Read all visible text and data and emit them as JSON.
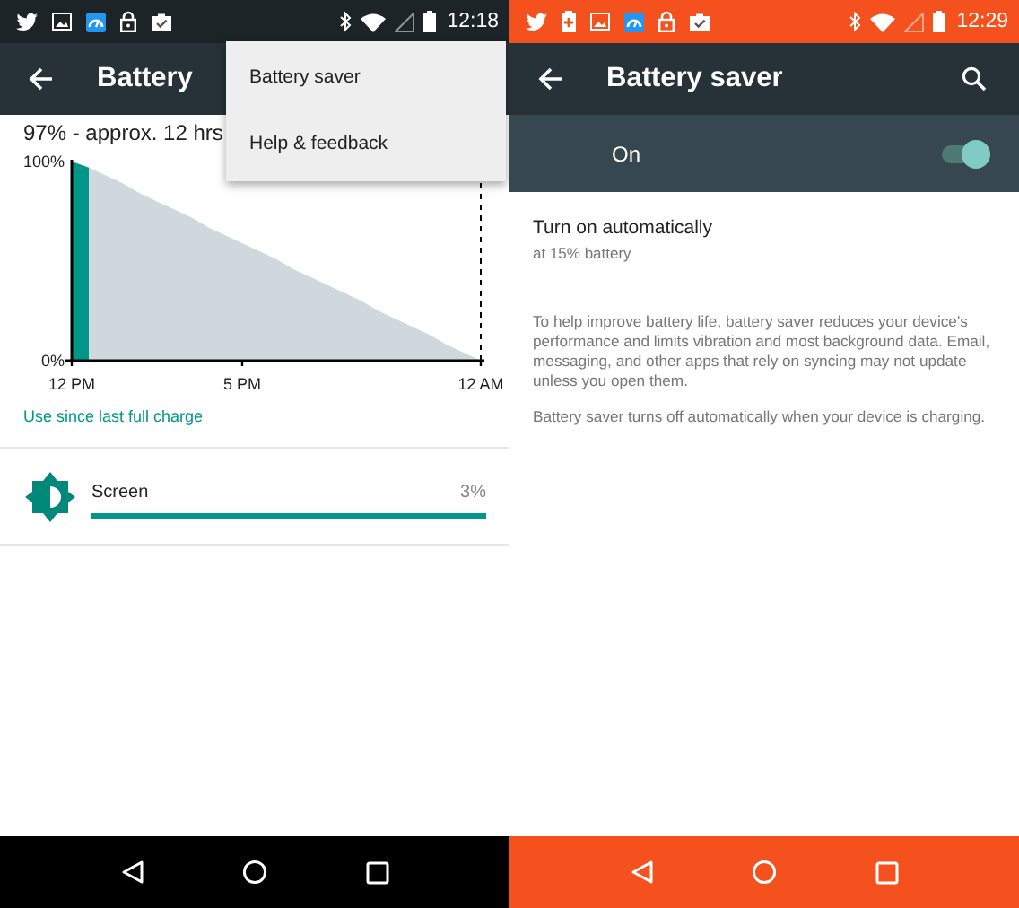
{
  "left_screen": {
    "status_bar": {
      "time": "12:18"
    },
    "toolbar": {
      "title": "Battery"
    },
    "summary": "97% - approx. 12 hrs",
    "chart_data": {
      "type": "area",
      "categories": [
        "12 PM",
        null,
        null,
        null,
        null,
        null,
        null,
        null,
        null,
        null,
        "5 PM",
        null,
        null,
        null,
        null,
        null,
        null,
        null,
        null,
        null,
        null,
        null,
        null,
        null,
        "12 AM"
      ],
      "yticks": [
        {
          "value": 0,
          "label": "0%"
        },
        {
          "value": 100,
          "label": "100%"
        }
      ],
      "ylim": [
        0,
        100
      ],
      "series": [
        {
          "color": "#009688",
          "values": [
            100,
            97,
            null,
            null,
            null,
            null,
            null,
            null,
            null,
            null,
            null,
            null,
            null,
            null,
            null,
            null,
            null,
            null,
            null,
            null,
            null,
            null,
            null,
            null,
            null
          ]
        },
        {
          "color": "#cfd8dc",
          "values": [
            null,
            97,
            93,
            89,
            84,
            80,
            76,
            72,
            67,
            63,
            59,
            55,
            51,
            46,
            42,
            38,
            34,
            30,
            25,
            21,
            17,
            13,
            8,
            4,
            0
          ]
        }
      ]
    },
    "history_link": "Use since last full charge",
    "usage": [
      {
        "name": "Screen",
        "percent": "3%",
        "level": 1
      }
    ],
    "overflow_menu": [
      {
        "label": "Battery saver"
      },
      {
        "label": "Help & feedback"
      }
    ]
  },
  "right_screen": {
    "status_bar": {
      "time": "12:29"
    },
    "toolbar": {
      "title": "Battery saver"
    },
    "master_switch": {
      "label": "On",
      "on": true
    },
    "auto": {
      "title": "Turn on automatically",
      "summary": "at 15% battery"
    },
    "paragraphs": [
      "To help improve battery life, battery saver reduces your device's performance and limits vibration and most background data. Email, messaging, and other apps that rely on syncing may not update unless you open them.",
      "Battery saver turns off automatically when your device is charging."
    ]
  }
}
